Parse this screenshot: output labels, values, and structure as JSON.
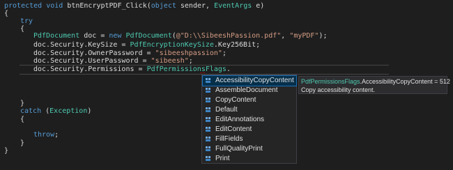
{
  "code": {
    "l1": {
      "a": "protected",
      "b": " ",
      "c": "void",
      "d": " btnEncryptPDF_Click(",
      "e": "object",
      "f": " sender, ",
      "g": "EventArgs",
      "h": " e)"
    },
    "l2": "{",
    "l3": "try",
    "l4": "{",
    "l5": {
      "a": "PdfDocument",
      "b": " doc = ",
      "c": "new",
      "d": " ",
      "e": "PdfDocument",
      "f": "(",
      "g": "@\"D:\\\\SibeeshPassion.pdf\"",
      "h": ", ",
      "i": "\"myPDF\"",
      "j": ");"
    },
    "l6": {
      "a": "doc.Security.KeySize = ",
      "b": "PdfEncryptionKeySize",
      "c": ".Key256Bit;"
    },
    "l7": {
      "a": "doc.Security.OwnerPassword = ",
      "b": "\"sibeeshpassion\"",
      "c": ";"
    },
    "l8": {
      "a": "doc.Security.UserPassword = ",
      "b": "\"sibeesh\"",
      "c": ";"
    },
    "l9": {
      "a": "doc.Security.Permissions = ",
      "b": "PdfPermissionsFlags",
      "c": "."
    },
    "l10": "}",
    "l11": {
      "a": "catch",
      "b": " (",
      "c": "Exception",
      "d": ")"
    },
    "l12": "{",
    "l13": {
      "a": "throw",
      "b": ";"
    },
    "l14": "}",
    "l15": "}"
  },
  "intellisense": {
    "items": [
      "AccessibilityCopyContent",
      "AssembleDocument",
      "CopyContent",
      "Default",
      "EditAnnotations",
      "EditContent",
      "FillFields",
      "FullQualityPrint",
      "Print"
    ],
    "selected_index": 0,
    "icon": "enum-member-icon"
  },
  "tooltip": {
    "type": "PdfPermissionsFlags",
    "member": ".AccessibilityCopyContent = 512",
    "description": "Copy accessibility content."
  },
  "colors": {
    "background": "#1e1e1e",
    "keyword": "#569cd6",
    "type": "#4ec9b0",
    "string": "#d69d85",
    "text": "#dcdcdc",
    "selection": "#062f4a"
  }
}
